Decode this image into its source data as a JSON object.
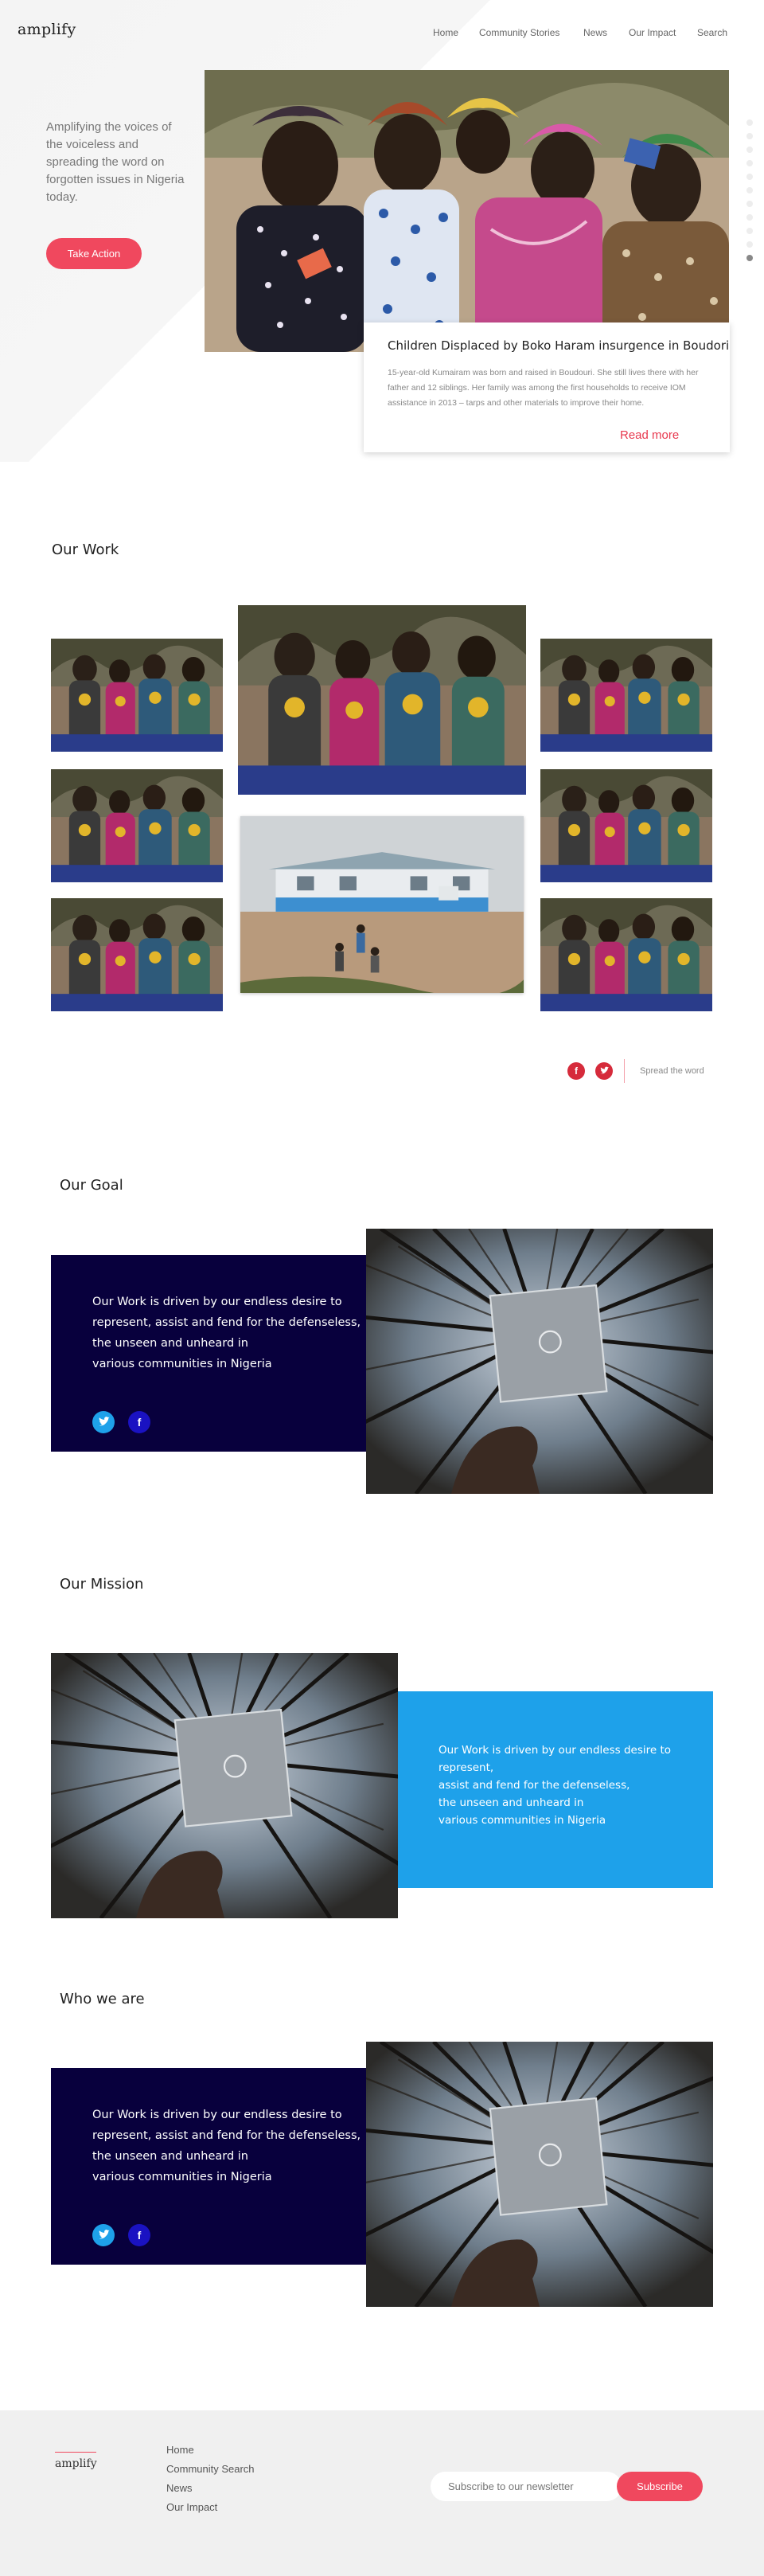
{
  "brand": {
    "logo": "amplify",
    "accent": "#f0485e",
    "navy": "#08003d",
    "blue": "#1ea1ea"
  },
  "nav": {
    "items": [
      {
        "label": "Home"
      },
      {
        "label": "Community Stories"
      },
      {
        "label": "News"
      },
      {
        "label": "Our Impact"
      },
      {
        "label": "Search"
      }
    ]
  },
  "hero": {
    "tagline": "Amplifying the voices of the voiceless and spreading the word on forgotten issues in Nigeria today.",
    "cta_label": "Take Action"
  },
  "story_card": {
    "title": "Children Displaced by Boko Haram insurgence in Boudori",
    "body": "15-year-old Kumairam was born and raised in Boudouri. She still lives there with her father and 12 siblings. Her family was among the first households to receive IOM assistance in 2013 – tarps and other materials to improve their home.",
    "read_more": "Read more"
  },
  "our_work": {
    "title": "Our Work",
    "share_label": "Spread the word"
  },
  "goal": {
    "title": "Our Goal",
    "text_lines": [
      "Our Work is driven by our endless desire to",
      "represent, assist and fend for the defenseless,",
      "the unseen and unheard in",
      "various communities in Nigeria"
    ]
  },
  "mission": {
    "title": "Our Mission",
    "text_lines": [
      "Our Work is driven by our endless desire to represent,",
      "assist and fend for the defenseless,",
      "the unseen and unheard in",
      "various communities in Nigeria"
    ]
  },
  "who": {
    "title": "Who we are",
    "text_lines": [
      "Our Work is driven by our endless desire to",
      "represent, assist and fend for the defenseless,",
      "the unseen and unheard in",
      "various communities in Nigeria"
    ]
  },
  "footer": {
    "logo": "amplify",
    "links": [
      {
        "label": "Home"
      },
      {
        "label": "Community Search"
      },
      {
        "label": "News"
      },
      {
        "label": "Our Impact"
      }
    ],
    "newsletter_placeholder": "Subscribe to our newsletter",
    "subscribe_label": "Subscribe"
  }
}
